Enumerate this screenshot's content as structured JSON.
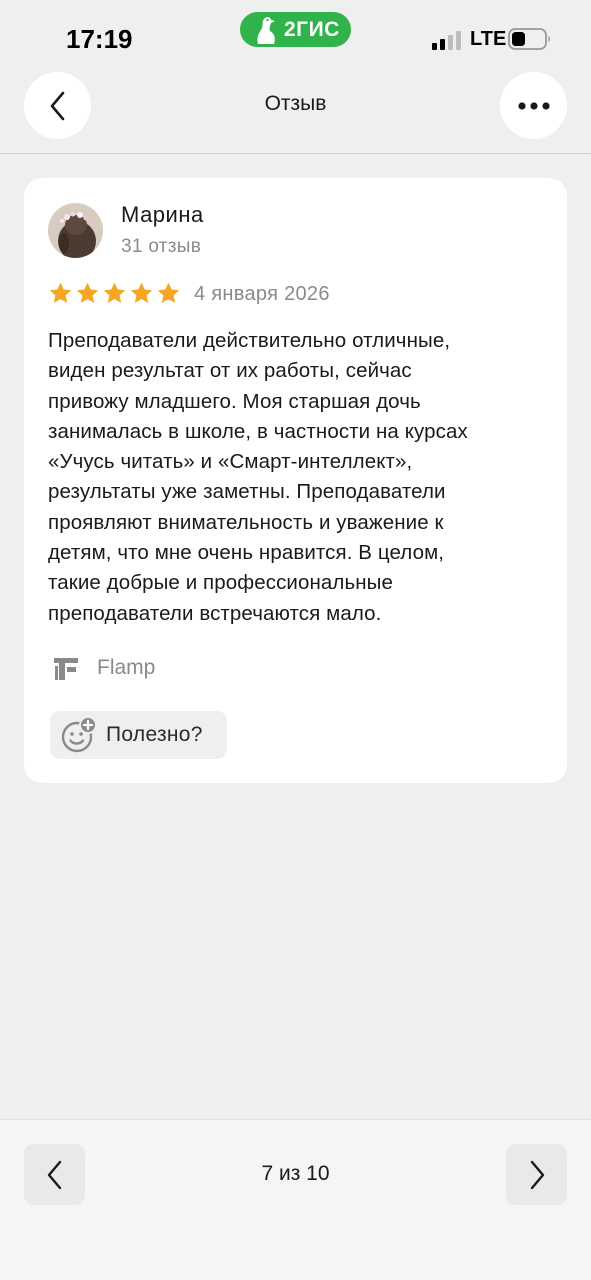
{
  "status_bar": {
    "time": "17:19",
    "brand": "2ГИС",
    "carrier": "LTE"
  },
  "header": {
    "title": "Отзыв",
    "back_icon": "chevron-left-icon",
    "more_icon": "more-horizontal-icon"
  },
  "review": {
    "author": "Марина",
    "reviews_count": "31 отзыв",
    "rating": 5,
    "date": "4 января 2026",
    "text": "Преподаватели действительно отличные,\nвиден результат от их работы, сейчас\nпривожу младшего. Моя старшая дочь\nзанималась в школе, в частности на курсах\n«Учусь читать» и «Смарт-интеллект»,\nрезультаты уже заметны. Преподаватели\nпроявляют внимательность и уважение к\nдетям, что мне очень нравится. В целом,\nтакие добрые и профессиональные\nпреподаватели встречаются мало.",
    "source": "Flamp",
    "useful_label": "Полезно?"
  },
  "pager": {
    "label": "7 из 10",
    "prev_icon": "chevron-left-icon",
    "next_icon": "chevron-right-icon"
  },
  "colors": {
    "brand_green": "#2fb34a",
    "star": "#f5a623",
    "background": "#efeff0"
  }
}
